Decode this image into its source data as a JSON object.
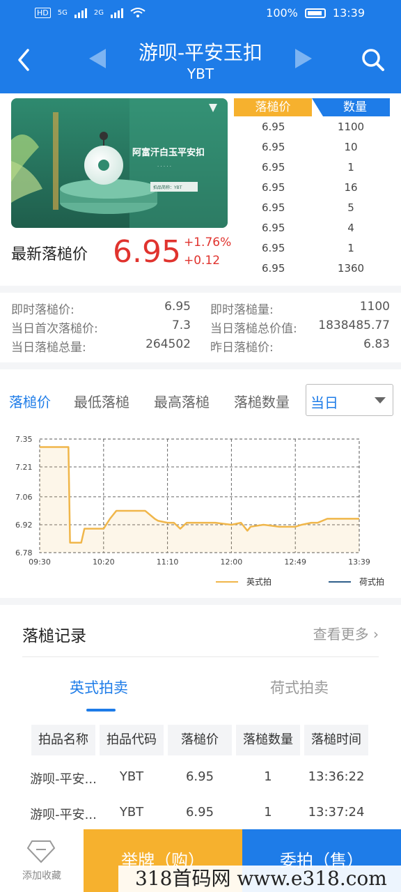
{
  "status_bar": {
    "left_chip": "HD",
    "net1": "5G",
    "net2": "2G",
    "battery": "100%",
    "time": "13:39"
  },
  "header": {
    "title": "游呗-平安玉扣",
    "code": "YBT"
  },
  "product": {
    "image_headline": "阿富汗白玉平安扣",
    "image_code_label": "拍品简称：YBT",
    "latest_label": "最新落槌价",
    "latest_price": "6.95",
    "change_pct": "+1.76%",
    "change_abs": "+0.12"
  },
  "order_book": {
    "price_header": "落槌价",
    "qty_header": "数量",
    "rows": [
      {
        "price": "6.95",
        "qty": "1100"
      },
      {
        "price": "6.95",
        "qty": "10"
      },
      {
        "price": "6.95",
        "qty": "1"
      },
      {
        "price": "6.95",
        "qty": "16"
      },
      {
        "price": "6.95",
        "qty": "5"
      },
      {
        "price": "6.95",
        "qty": "4"
      },
      {
        "price": "6.95",
        "qty": "1"
      },
      {
        "price": "6.95",
        "qty": "1360"
      }
    ]
  },
  "stats": {
    "instant_price_label": "即时落槌价:",
    "instant_price": "6.95",
    "instant_qty_label": "即时落槌量:",
    "instant_qty": "1100",
    "first_price_label": "当日首次落槌价:",
    "first_price": "7.3",
    "total_value_label": "当日落槌总价值:",
    "total_value": "1838485.77",
    "total_qty_label": "当日落槌总量:",
    "total_qty": "264502",
    "yesterday_label": "昨日落槌价:",
    "yesterday": "6.83"
  },
  "chart_tabs": [
    "落槌价",
    "最低落槌",
    "最高落槌",
    "落槌数量"
  ],
  "chart_range": "当日",
  "chart_data": {
    "type": "line",
    "x_ticks": [
      "09:30",
      "10:20",
      "11:10",
      "12:00",
      "12:49",
      "13:39"
    ],
    "y_ticks": [
      "7.35",
      "7.21",
      "7.06",
      "6.92",
      "6.78"
    ],
    "ylim": [
      6.78,
      7.35
    ],
    "series": [
      {
        "name": "英式拍",
        "color": "#f0b64a",
        "x": [
          0,
          0.05,
          0.09,
          0.095,
          0.13,
          0.14,
          0.2,
          0.22,
          0.24,
          0.25,
          0.3,
          0.33,
          0.36,
          0.37,
          0.4,
          0.42,
          0.44,
          0.46,
          0.5,
          0.55,
          0.6,
          0.63,
          0.65,
          0.66,
          0.7,
          0.75,
          0.8,
          0.82,
          0.85,
          0.87,
          0.9,
          0.95,
          1.0
        ],
        "y": [
          7.31,
          7.31,
          7.31,
          6.83,
          6.83,
          6.9,
          6.9,
          6.95,
          6.99,
          6.99,
          6.99,
          6.99,
          6.95,
          6.94,
          6.93,
          6.93,
          6.9,
          6.93,
          6.93,
          6.93,
          6.92,
          6.93,
          6.89,
          6.91,
          6.92,
          6.91,
          6.91,
          6.92,
          6.93,
          6.93,
          6.95,
          6.95,
          6.95
        ]
      }
    ],
    "legend": [
      "英式拍",
      "荷式拍"
    ],
    "legend_colors": [
      "#f0b64a",
      "#2f5f8a"
    ]
  },
  "records": {
    "title": "落槌记录",
    "more": "查看更多",
    "tabs": [
      "英式拍卖",
      "荷式拍卖"
    ],
    "columns": [
      "拍品名称",
      "拍品代码",
      "落槌价",
      "落槌数量",
      "落槌时间"
    ],
    "rows": [
      [
        "游呗-平安...",
        "YBT",
        "6.95",
        "1",
        "13:36:22"
      ],
      [
        "游呗-平安...",
        "YBT",
        "6.95",
        "1",
        "13:37:24"
      ]
    ]
  },
  "bottom": {
    "fav": "添加收藏",
    "buy": "举牌（购）",
    "sell": "委拍（售）"
  },
  "watermark": "318首码网  www.e318.com"
}
